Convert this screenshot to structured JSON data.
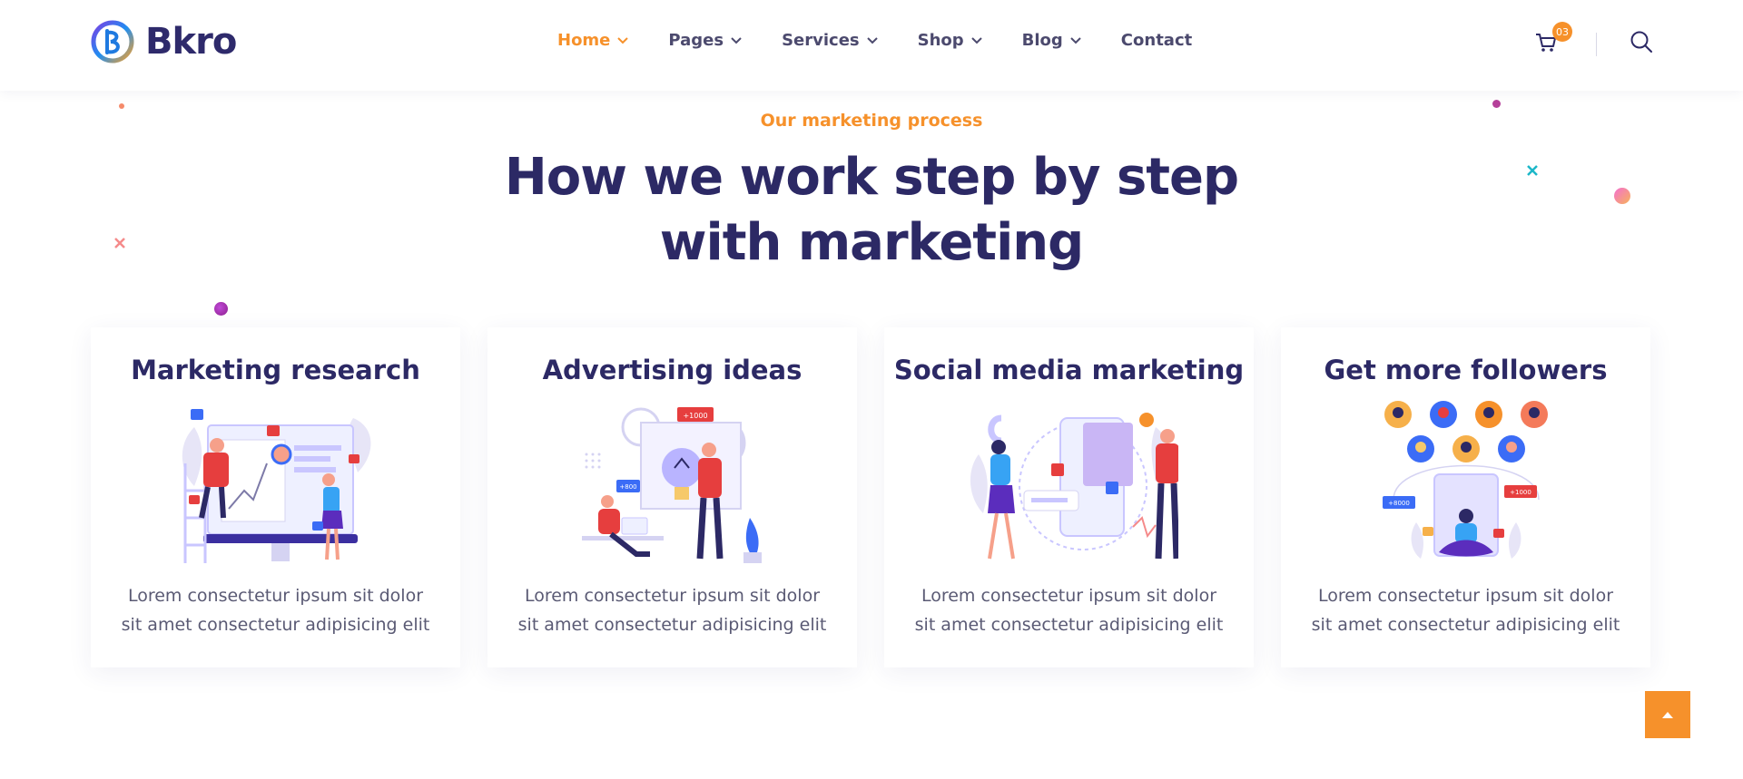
{
  "header": {
    "logo_text": "Bkro",
    "nav": [
      {
        "label": "Home",
        "has_dropdown": true,
        "active": true
      },
      {
        "label": "Pages",
        "has_dropdown": true,
        "active": false
      },
      {
        "label": "Services",
        "has_dropdown": true,
        "active": false
      },
      {
        "label": "Shop",
        "has_dropdown": true,
        "active": false
      },
      {
        "label": "Blog",
        "has_dropdown": true,
        "active": false
      },
      {
        "label": "Contact",
        "has_dropdown": false,
        "active": false
      }
    ],
    "cart_count": "03",
    "icons": {
      "cart": "cart-icon",
      "search": "search-icon"
    }
  },
  "section": {
    "eyebrow": "Our marketing process",
    "headline": "How we work step by step with marketing"
  },
  "cards": [
    {
      "title": "Marketing research",
      "text": "Lorem consectetur ipsum sit dolor sit amet consectetur adipisicing elit",
      "illustration": "marketing-research-illustration"
    },
    {
      "title": "Advertising ideas",
      "text": "Lorem consectetur ipsum sit dolor sit amet consectetur adipisicing elit",
      "illustration": "advertising-ideas-illustration"
    },
    {
      "title": "Social media marketing",
      "text": "Lorem consectetur ipsum sit dolor sit amet consectetur adipisicing elit",
      "illustration": "social-media-illustration"
    },
    {
      "title": "Get more followers",
      "text": "Lorem consectetur ipsum sit dolor sit amet consectetur adipisicing elit",
      "illustration": "followers-illustration"
    }
  ],
  "illustration_labels": {
    "advertising_badge_1": "+1000",
    "advertising_badge_2": "+800",
    "followers_badge_1": "+8000",
    "followers_badge_2": "+1000"
  },
  "colors": {
    "accent": "#f6912b",
    "heading": "#2c2965",
    "body_text": "#5a5a74",
    "nav_text": "#4c4a6e"
  },
  "back_to_top": {
    "icon": "arrow-up-icon"
  }
}
